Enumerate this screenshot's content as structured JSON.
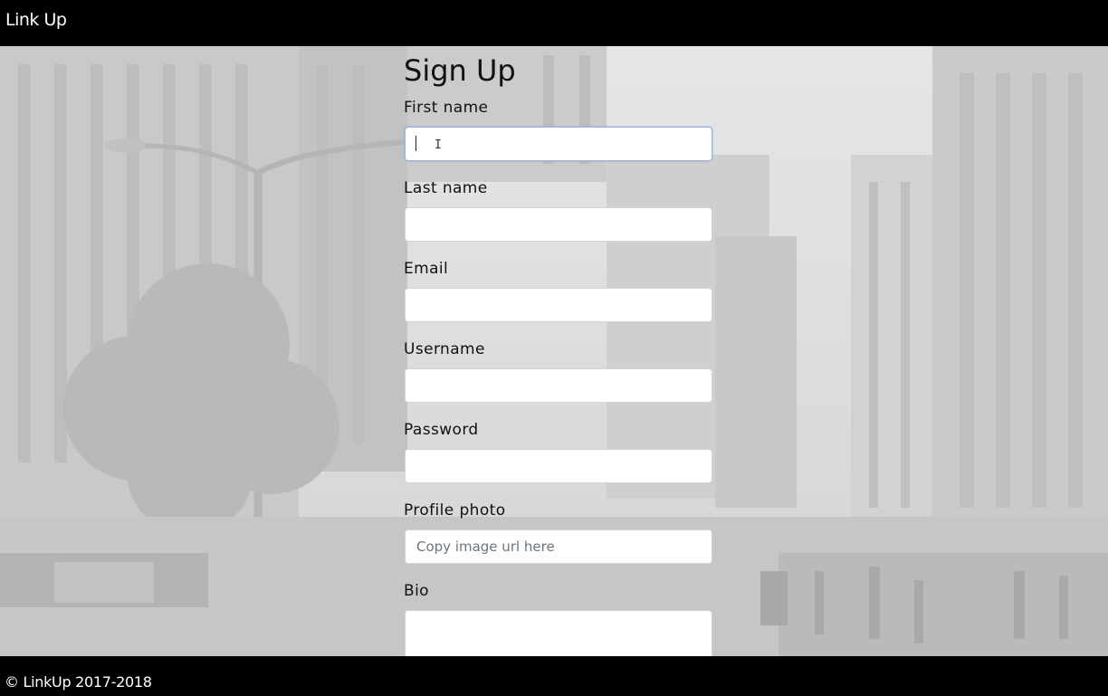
{
  "navbar": {
    "brand": "Link Up"
  },
  "signup": {
    "title": "Sign Up",
    "fields": [
      {
        "label": "First name",
        "value": "",
        "placeholder": ""
      },
      {
        "label": "Last name",
        "value": "",
        "placeholder": ""
      },
      {
        "label": "Email",
        "value": "",
        "placeholder": ""
      },
      {
        "label": "Username",
        "value": "",
        "placeholder": ""
      },
      {
        "label": "Password",
        "value": "",
        "placeholder": ""
      },
      {
        "label": "Profile photo",
        "value": "",
        "placeholder": "Copy image url here"
      },
      {
        "label": "Bio",
        "value": "",
        "placeholder": ""
      }
    ]
  },
  "footer": {
    "copyright": "© LinkUp 2017-2018"
  },
  "colors": {
    "bar": "#000000",
    "bar_text": "#ffffff",
    "text": "#111111",
    "focus_border": "#9ab8e0"
  }
}
